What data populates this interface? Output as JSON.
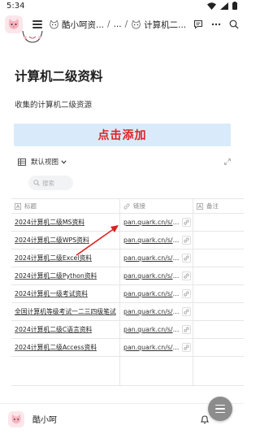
{
  "status_bar": {
    "time": "5:34"
  },
  "nav": {
    "crumb_1": "酷小呵资...",
    "crumb_2": "...",
    "crumb_3": "计算机二...",
    "separator": "/"
  },
  "page": {
    "title": "计算机二级资料",
    "description": "收集的计算机二级资源"
  },
  "banner": {
    "text": "点击添加",
    "text_color": "#e02020",
    "bg_color": "#d9ebfb"
  },
  "view": {
    "label": "默认视图"
  },
  "search": {
    "placeholder": "搜索"
  },
  "table": {
    "headers": {
      "title": "标题",
      "link": "链接",
      "notes": "备注"
    },
    "rows": [
      {
        "title": "2024计算机二级MS资料",
        "link": "pan.quark.cn/s/8..."
      },
      {
        "title": "2024计算机二级WPS资料",
        "link": "pan.quark.cn/s/b..."
      },
      {
        "title": "2024计算机二级Excel资料",
        "link": "pan.quark.cn/s/7..."
      },
      {
        "title": "2024计算机二级Python资料",
        "link": "pan.quark.cn/s/8..."
      },
      {
        "title": "2024计算机一级考试资料",
        "link": "pan.quark.cn/s/7..."
      },
      {
        "title": "全国计算机等级考试一二三四级笔试",
        "link": "pan.quark.cn/s/3..."
      },
      {
        "title": "2024计算机二级C语言资料",
        "link": "pan.quark.cn/s/1..."
      },
      {
        "title": "2024计算机二级Access资料",
        "link": "pan.quark.cn/s/5..."
      }
    ]
  },
  "bottom_bar": {
    "name": "酷小呵"
  },
  "colors": {
    "annotation_arrow": "#e02020"
  }
}
